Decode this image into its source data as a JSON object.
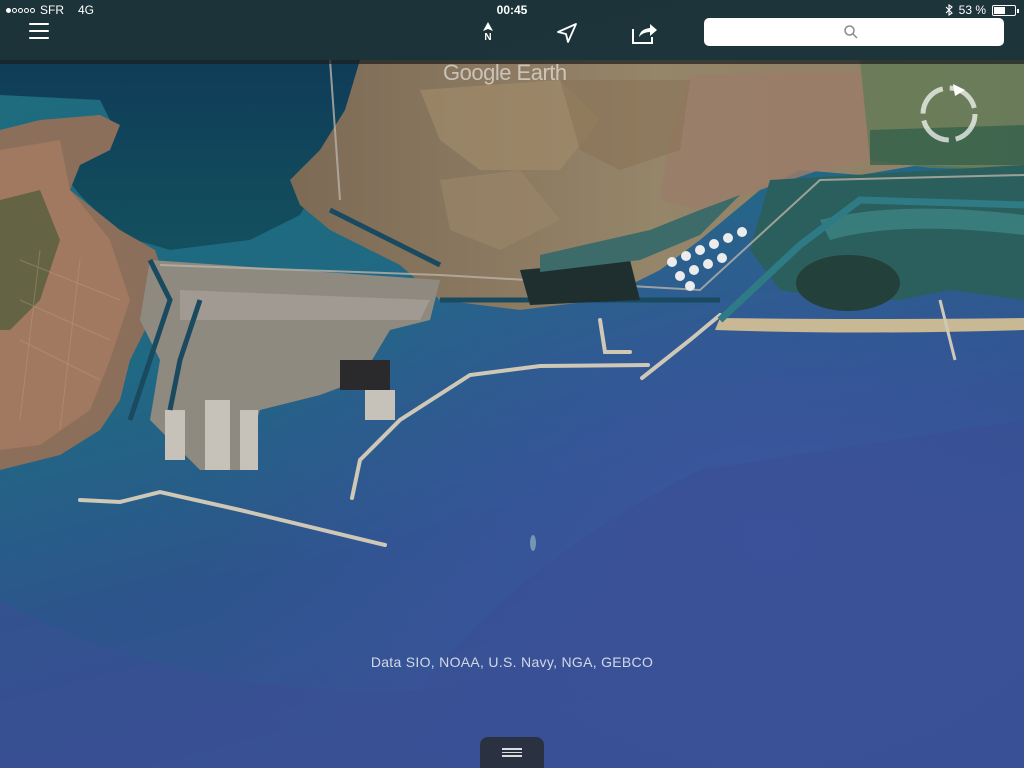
{
  "status_bar": {
    "carrier": "SFR",
    "network": "4G",
    "time": "00:45",
    "battery_percent": "53 %",
    "battery_level": 0.53,
    "signal_bars_full": 1,
    "signal_bars_total": 5
  },
  "toolbar": {
    "north_label": "N",
    "search_placeholder": "",
    "icons": [
      "hamburger-menu-icon",
      "north-arrow-icon",
      "my-location-icon",
      "share-icon",
      "search-icon"
    ]
  },
  "map": {
    "logo_text": "Google Earth",
    "attribution": "Data SIO, NOAA, U.S. Navy, NGA, GEBCO",
    "colors": {
      "deep_sea": "#34508f",
      "shallow_sea": "#1f6f80",
      "land_dry": "#8f8468",
      "land_urban": "#9b7a6a",
      "lagoon": "#2f6a66"
    }
  },
  "bottom_panel": {
    "handle_icon": "drag-handle-icon"
  }
}
